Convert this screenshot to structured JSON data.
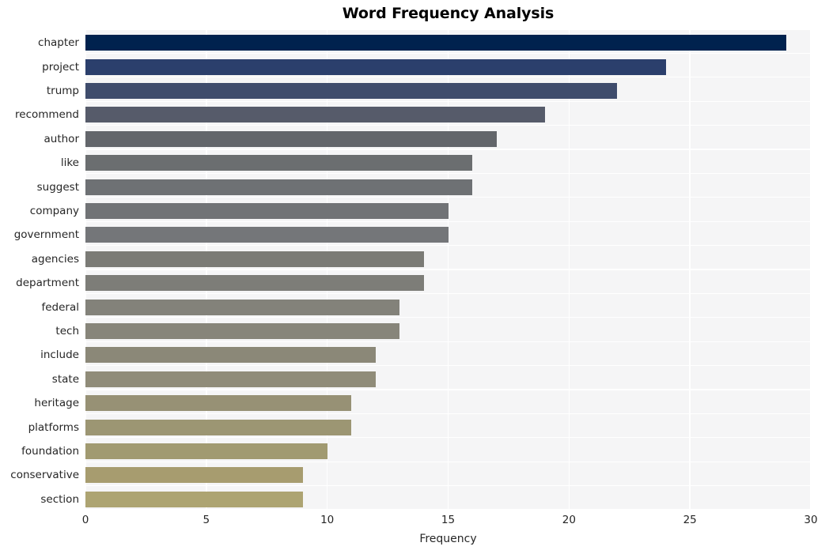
{
  "chart_data": {
    "type": "bar",
    "orientation": "horizontal",
    "title": "Word Frequency Analysis",
    "xlabel": "Frequency",
    "ylabel": "",
    "xlim": [
      0,
      30
    ],
    "xticks": [
      0,
      5,
      10,
      15,
      20,
      25,
      30
    ],
    "xtick_labels": [
      "0",
      "5",
      "10",
      "15",
      "20",
      "25",
      "30"
    ],
    "grid": true,
    "legend": null,
    "categories": [
      "chapter",
      "project",
      "trump",
      "recommend",
      "author",
      "like",
      "suggest",
      "company",
      "government",
      "agencies",
      "department",
      "federal",
      "tech",
      "include",
      "state",
      "heritage",
      "platforms",
      "foundation",
      "conservative",
      "section"
    ],
    "values": [
      29,
      24,
      22,
      19,
      17,
      16,
      16,
      15,
      15,
      14,
      14,
      13,
      13,
      12,
      12,
      11,
      11,
      10,
      9,
      9
    ],
    "bar_colors": [
      "#00224e",
      "#2b3f6c",
      "#3f4c6c",
      "#565b6a",
      "#63666b",
      "#6b6e70",
      "#6e7174",
      "#717376",
      "#747679",
      "#7b7b76",
      "#7d7d78",
      "#83827a",
      "#87857a",
      "#8b8878",
      "#908c79",
      "#979175",
      "#9c9673",
      "#a19a71",
      "#a79c6f",
      "#ada472"
    ]
  },
  "style": {
    "plot_background": "#f5f5f6",
    "grid_color": "#ffffff",
    "figure_background": "#ffffff",
    "text_color": "#262626"
  }
}
